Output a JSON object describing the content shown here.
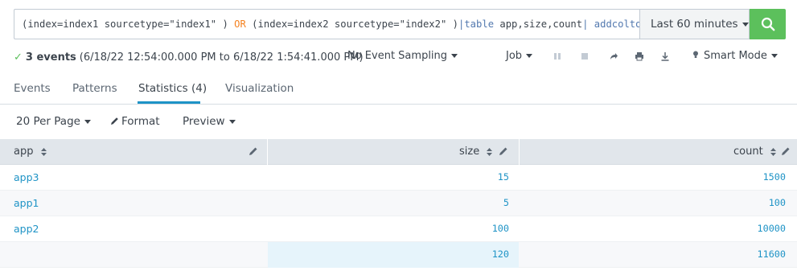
{
  "search": {
    "query_parts": [
      {
        "text": "(index=index1 sourcetype=\"index1\" ) ",
        "cls": ""
      },
      {
        "text": "OR",
        "cls": "s-kw"
      },
      {
        "text": " (index=index2 sourcetype=\"index2\" )",
        "cls": ""
      },
      {
        "text": "|",
        "cls": "s-pipe"
      },
      {
        "text": "table",
        "cls": "s-pipe"
      },
      {
        "text": " app,size,count",
        "cls": ""
      },
      {
        "text": "| ",
        "cls": "s-pipe"
      },
      {
        "text": "addcoltotals",
        "cls": "s-pipe"
      }
    ],
    "time_range": "Last 60 minutes",
    "search_icon": "search-icon",
    "submit_color": "#5cc05c"
  },
  "status": {
    "events": "3 events",
    "range": "(6/18/22 12:54:00.000 PM to 6/18/22 1:54:41.000 PM)",
    "sampling": "No Event Sampling",
    "job": "Job",
    "mode": "Smart Mode",
    "icons": [
      "pause-icon",
      "stop-icon",
      "share-icon",
      "print-icon",
      "export-icon",
      "bulb-icon"
    ]
  },
  "tabs": [
    {
      "label": "Events"
    },
    {
      "label": "Patterns"
    },
    {
      "label": "Statistics (4)",
      "active": true
    },
    {
      "label": "Visualization"
    }
  ],
  "controls": {
    "per_page": "20 Per Page",
    "format": "Format",
    "preview": "Preview"
  },
  "table": {
    "columns": [
      "app",
      "size",
      "count"
    ],
    "rows": [
      [
        "app3",
        "15",
        "1500"
      ],
      [
        "app1",
        "5",
        "100"
      ],
      [
        "app2",
        "100",
        "10000"
      ],
      [
        "",
        "120",
        "11600"
      ]
    ],
    "accent_color": "#1e93c6"
  }
}
